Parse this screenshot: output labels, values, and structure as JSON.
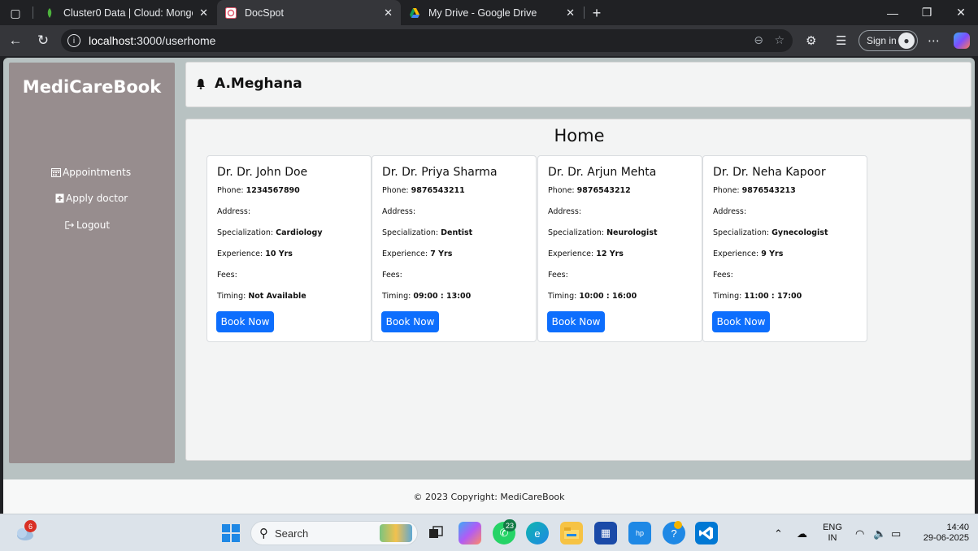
{
  "browser": {
    "tabs": [
      {
        "title": "Cluster0 Data | Cloud: MongoDB",
        "active": false
      },
      {
        "title": "DocSpot",
        "active": true
      },
      {
        "title": "My Drive - Google Drive",
        "active": false
      }
    ],
    "url_host": "localhost",
    "url_path": ":3000/userhome",
    "sign_in_label": "Sign in"
  },
  "sidebar": {
    "brand": "MediCareBook",
    "items": [
      {
        "label": "Appointments"
      },
      {
        "label": "Apply doctor"
      },
      {
        "label": "Logout"
      }
    ]
  },
  "header": {
    "user_name": "A.Meghana"
  },
  "main": {
    "title": "Home",
    "labels": {
      "phone": "Phone:",
      "address": "Address:",
      "specialization": "Specialization:",
      "experience": "Experience:",
      "fees": "Fees:",
      "timing": "Timing:"
    },
    "doctors": [
      {
        "name": "Dr. Dr. John Doe",
        "phone": "1234567890",
        "address": "",
        "specialization": "Cardiology",
        "experience": "10 Yrs",
        "fees": "",
        "timing": "Not Available",
        "book_label": "Book Now"
      },
      {
        "name": "Dr. Dr. Priya Sharma",
        "phone": "9876543211",
        "address": "",
        "specialization": "Dentist",
        "experience": "7 Yrs",
        "fees": "",
        "timing": "09:00 : 13:00",
        "book_label": "Book Now"
      },
      {
        "name": "Dr. Dr. Arjun Mehta",
        "phone": "9876543212",
        "address": "",
        "specialization": "Neurologist",
        "experience": "12 Yrs",
        "fees": "",
        "timing": "10:00 : 16:00",
        "book_label": "Book Now"
      },
      {
        "name": "Dr. Dr. Neha Kapoor",
        "phone": "9876543213",
        "address": "",
        "specialization": "Gynecologist",
        "experience": "9 Yrs",
        "fees": "",
        "timing": "11:00 : 17:00",
        "book_label": "Book Now"
      }
    ]
  },
  "footer": {
    "text": "© 2023 Copyright: MediCareBook"
  },
  "taskbar": {
    "weather_badge": "6",
    "search_label": "Search",
    "whatsapp_badge": "23",
    "language": "ENG",
    "region": "IN",
    "time": "14:40",
    "date": "29-06-2025"
  },
  "colors": {
    "sidebar": "#978d8e",
    "page_bg": "#b8c2c2",
    "primary_button": "#0d6efd"
  }
}
